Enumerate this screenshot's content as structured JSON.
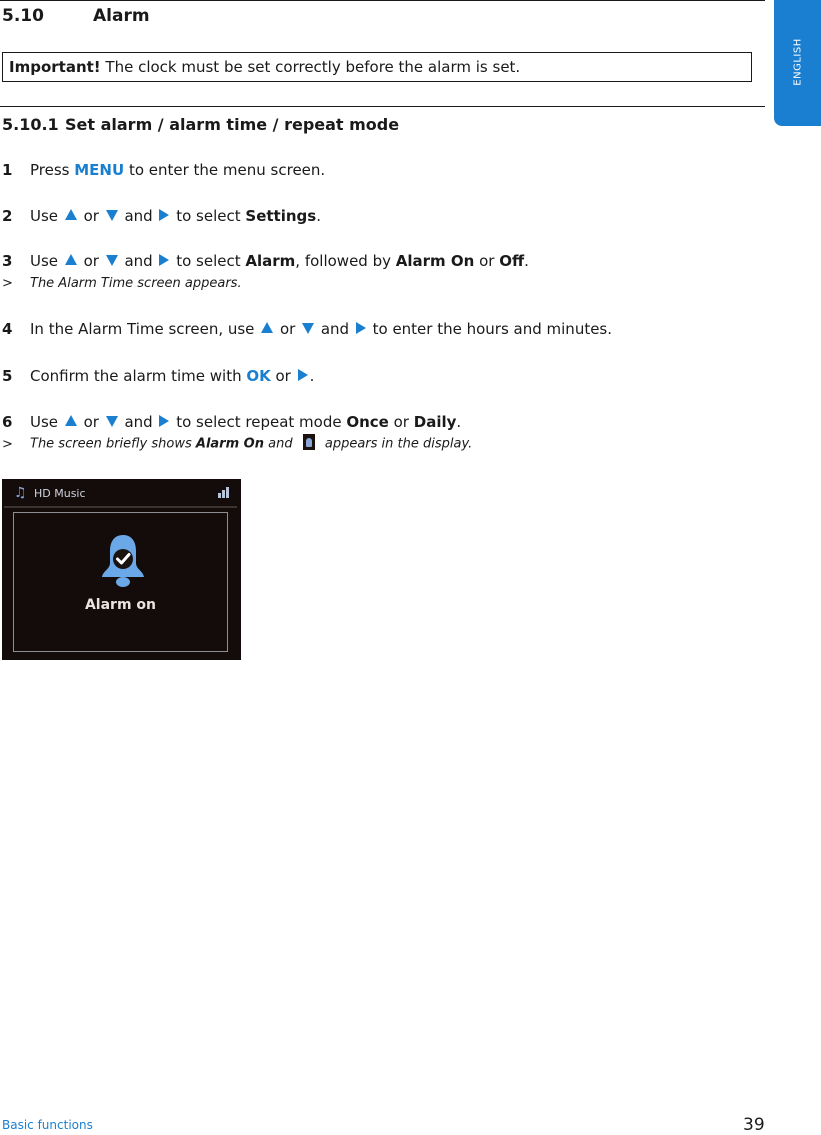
{
  "section": {
    "number": "5.10",
    "title": "Alarm"
  },
  "important": {
    "label": "Important!",
    "text": " The clock must be set correctly before the alarm is set."
  },
  "subsection": {
    "number": "5.10.1",
    "title": "Set alarm / alarm time / repeat mode"
  },
  "steps": [
    {
      "n": "1",
      "press": "Press ",
      "key": "MENU",
      "rest": " to enter the menu screen."
    },
    {
      "n": "2",
      "use": "Use ",
      "or": " or ",
      "and": " and ",
      "to": " to select ",
      "target": "Settings",
      "end": "."
    },
    {
      "n": "3",
      "use": "Use ",
      "or": " or ",
      "and": " and ",
      "to": " to select ",
      "target": "Alarm",
      "mid": ", followed by ",
      "opt1": "Alarm On",
      "or2": " or ",
      "opt2": "Off",
      "end": ".",
      "result_marker": ">",
      "result": "The Alarm Time screen appears."
    },
    {
      "n": "4",
      "lead": "In the Alarm Time screen, use ",
      "or": " or ",
      "and": " and ",
      "rest": " to enter the hours and minutes."
    },
    {
      "n": "5",
      "lead": "Confirm the alarm time with ",
      "key": "OK",
      "or": " or ",
      "end": "."
    },
    {
      "n": "6",
      "use": "Use ",
      "or": " or ",
      "and": " and ",
      "to": " to select repeat mode ",
      "opt1": "Once",
      "or2": " or ",
      "opt2": "Daily",
      "end": ".",
      "result_marker": ">",
      "result_a": "The screen briefly shows ",
      "result_bold": "Alarm On",
      "result_b": " and ",
      "result_c": " appears in the display."
    }
  ],
  "icons": {
    "up": "up-arrow-icon",
    "down": "down-arrow-icon",
    "right": "right-arrow-icon",
    "bell": "alarm-bell-icon"
  },
  "device_screen": {
    "title": "HD Music",
    "message": "Alarm on"
  },
  "side_tab": {
    "label": "ENGLISH"
  },
  "footer": {
    "chapter": "Basic functions",
    "page": "39"
  },
  "colors": {
    "accent": "#1b7fcf",
    "tab": "#1a7fd0"
  }
}
